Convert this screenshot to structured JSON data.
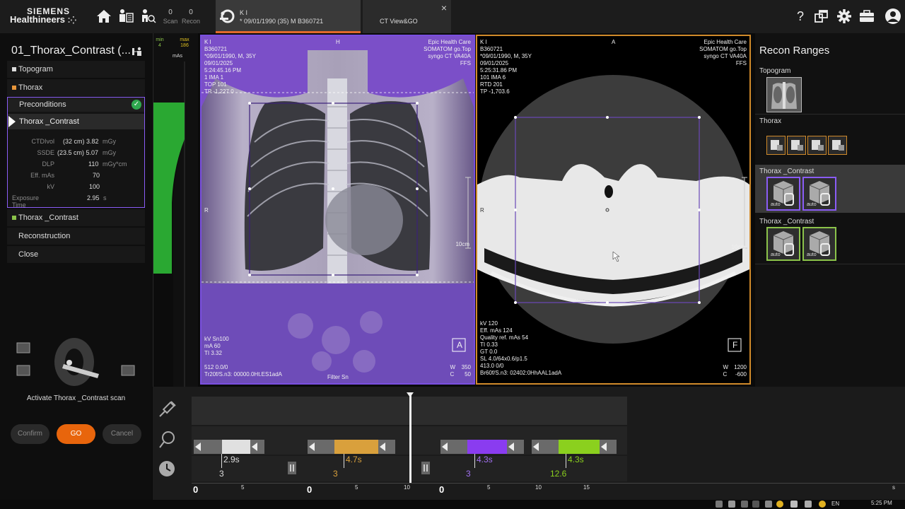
{
  "brand": {
    "line1": "SIEMENS",
    "line2": "Healthineers",
    "dots": "⁚⁛"
  },
  "topbar": {
    "counters": [
      {
        "value": "0",
        "label": "Scan"
      },
      {
        "value": "0",
        "label": "Recon"
      }
    ],
    "patient_tab": {
      "name": "K I",
      "info": "* 09/01/1990 (35) M B360721"
    },
    "view_tab": {
      "name": "CT View&GO",
      "close": "×"
    },
    "help_symbol": "?"
  },
  "left_panel": {
    "protocol_title": "01_Thorax_Contrast (...",
    "items": [
      {
        "label": "Topogram",
        "color": "#dddddd"
      },
      {
        "label": "Thorax",
        "color": "#e8963a"
      },
      {
        "label": "Thorax _Contrast",
        "color": "#8bc34a"
      },
      {
        "label": "Reconstruction"
      },
      {
        "label": "Close"
      }
    ],
    "preconditions": "Preconditions",
    "check": "✓",
    "active_item": "Thorax _Contrast",
    "params": {
      "ctdivol": {
        "label": "CTDIvol",
        "value": "(32 cm) 3.82",
        "unit": "mGy"
      },
      "ssde": {
        "label": "SSDE",
        "value": "(23.5 cm) 5.07",
        "unit": "mGy"
      },
      "dlp": {
        "label": "DLP",
        "value": "110",
        "unit": "mGy*cm"
      },
      "eff_mas": {
        "label": "Eff. mAs",
        "value": "70",
        "unit": ""
      },
      "kv": {
        "label": "kV",
        "value": "100",
        "unit": ""
      },
      "exposure": {
        "label": "Exposure Time",
        "value": "2.95",
        "unit": "s"
      }
    },
    "activate_text": "Activate Thorax _Contrast scan",
    "buttons": {
      "confirm": "Confirm",
      "go": "GO",
      "cancel": "Cancel"
    }
  },
  "mas_strip": {
    "min_label": "min",
    "min_value": "4",
    "max_label": "max",
    "max_value": "186",
    "unit": "mAs"
  },
  "viewer1": {
    "top_left": "K I\nB360721\n*09/01/1990, M, 35Y\n09/01/2025\n5:24:45.16 PM\n1 IMA 1\nTOP 101\nTP -1,227.0",
    "top_center": "H",
    "top_right": "Epic Health Care\nSOMATOM go.Top\nsyngo CT VA40A\nFFS",
    "left_mid": "R",
    "scale": "10cm",
    "bottom_left": "kV Sn100\nmA 60\nTI 3.32\n\n512 0.0/0\nTr20f/S.n3: 00000.0Ht.ES1adA",
    "bottom_center": "Filter Sn",
    "wc": "W\nC",
    "wc_values": "350\n50",
    "orientation_box": "A"
  },
  "viewer2": {
    "top_left": "K I\nB360721\n*09/01/1990, M, 35Y\n09/01/2025\n5:25:31.86 PM\n101 IMA 6\nRTD 201\nTP -1,703.6",
    "top_center": "A",
    "top_right": "Epic Health Care\nSOMATOM go.Top\nsyngo CT VA40A\nFFS",
    "left_mid": "R",
    "scale": "10cm",
    "bottom_left": "kV 120\nEff. mAs 124\nQuality ref. mAs 54\nTI 0.33\nGT 0.0\nSL 4.0/64x0.6/p1.5\n413.0 0/0\nBr60f/S.n3: 02402:0HhAAL1adA",
    "wc": "W\nC",
    "wc_values": "1200\n-600",
    "orientation_box": "F"
  },
  "recon_ranges": {
    "title": "Recon Ranges",
    "sections": [
      {
        "name": "Topogram"
      },
      {
        "name": "Thorax"
      },
      {
        "name": "Thorax _Contrast",
        "auto": "auto"
      },
      {
        "name": "Thorax _Contrast",
        "auto": "auto"
      }
    ]
  },
  "timeline": {
    "segments": [
      {
        "color": "#e0e0e0",
        "duration": "2.9s",
        "sub": "3",
        "duration_color": "#dddddd"
      },
      {
        "color": "#d9a03c",
        "duration": "4.7s",
        "sub": "3",
        "duration_color": "#d9a03c"
      },
      {
        "color": "#8a3cf0",
        "duration": "4.3s",
        "sub": "3",
        "duration_color": "#a070f0"
      },
      {
        "color": "#8bd01e",
        "duration": "4.3s",
        "sub": "12.6",
        "duration_color": "#8bd01e"
      }
    ],
    "axes": [
      {
        "start": "0",
        "ticks": [
          "5"
        ]
      },
      {
        "start": "0",
        "ticks": [
          "5",
          "10"
        ]
      },
      {
        "start": "0",
        "ticks": [
          "5",
          "10",
          "15"
        ]
      }
    ],
    "end_tick": "s"
  },
  "taskbar": {
    "language": "EN",
    "time": "5:25 PM"
  }
}
